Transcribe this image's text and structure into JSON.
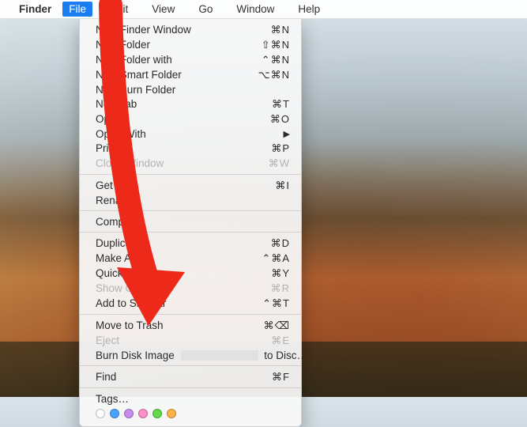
{
  "menubar": {
    "apple_icon": "",
    "app_name": "Finder",
    "items": [
      {
        "label": "File",
        "active": true
      },
      {
        "label": "Edit",
        "active": false
      },
      {
        "label": "View",
        "active": false
      },
      {
        "label": "Go",
        "active": false
      },
      {
        "label": "Window",
        "active": false
      },
      {
        "label": "Help",
        "active": false
      }
    ]
  },
  "dropdown": {
    "groups": [
      [
        {
          "label": "New Finder Window",
          "shortcut": "⌘N"
        },
        {
          "label": "New Folder",
          "shortcut": "⇧⌘N"
        },
        {
          "label": "New Folder with",
          "shortcut": "⌃⌘N"
        },
        {
          "label": "New Smart Folder",
          "shortcut": "⌥⌘N"
        },
        {
          "label": "New Burn Folder"
        },
        {
          "label": "New Tab",
          "shortcut": "⌘T"
        },
        {
          "label": "Open",
          "shortcut": "⌘O"
        },
        {
          "label": "Open With",
          "submenu": true
        },
        {
          "label": "Print",
          "shortcut": "⌘P"
        },
        {
          "label": "Close Window",
          "shortcut": "⌘W",
          "disabled": true
        }
      ],
      [
        {
          "label": "Get Info",
          "shortcut": "⌘I"
        },
        {
          "label": "Rename"
        }
      ],
      [
        {
          "label": "Compress"
        }
      ],
      [
        {
          "label": "Duplicate",
          "shortcut": "⌘D"
        },
        {
          "label": "Make Alias",
          "shortcut": "⌃⌘A"
        },
        {
          "label": "Quick Look",
          "shortcut": "⌘Y"
        },
        {
          "label": "Show Original",
          "shortcut": "⌘R",
          "disabled": true
        },
        {
          "label": "Add to Sidebar",
          "shortcut": "⌃⌘T"
        }
      ],
      [
        {
          "label": "Move to Trash",
          "shortcut": "⌘⌫"
        },
        {
          "label": "Eject",
          "shortcut": "⌘E",
          "disabled": true
        },
        {
          "label_before": "Burn Disk Image",
          "label_after": "to Disc…",
          "redacted": true
        }
      ],
      [
        {
          "label": "Find",
          "shortcut": "⌘F"
        }
      ],
      [
        {
          "label": "Tags…"
        }
      ]
    ],
    "tag_colors": [
      "none",
      "blue",
      "purple",
      "pink",
      "green",
      "orange"
    ]
  },
  "annotation": {
    "kind": "arrow",
    "color": "#ed2a1a"
  }
}
